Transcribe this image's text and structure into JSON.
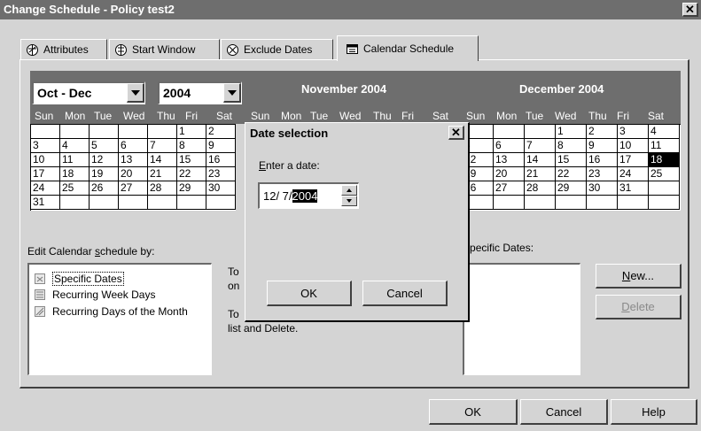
{
  "window": {
    "title": "Change Schedule - Policy test2",
    "close_glyph": "✕"
  },
  "tabs": [
    {
      "label": "Attributes",
      "icon": "attributes-icon"
    },
    {
      "label": "Start Window",
      "icon": "start-window-icon"
    },
    {
      "label": "Exclude Dates",
      "icon": "exclude-dates-icon"
    },
    {
      "label": "Calendar Schedule",
      "icon": "calendar-icon",
      "active": true
    }
  ],
  "calendar": {
    "range_select": "Oct - Dec",
    "year_select": "2004",
    "weekdays": [
      "Sun",
      "Mon",
      "Tue",
      "Wed",
      "Thu",
      "Fri",
      "Sat"
    ],
    "months": [
      {
        "title": "",
        "weeks": [
          [
            "",
            "",
            "",
            "",
            "",
            "1",
            "2"
          ],
          [
            "3",
            "4",
            "5",
            "6",
            "7",
            "8",
            "9"
          ],
          [
            "10",
            "11",
            "12",
            "13",
            "14",
            "15",
            "16"
          ],
          [
            "17",
            "18",
            "19",
            "20",
            "21",
            "22",
            "23"
          ],
          [
            "24",
            "25",
            "26",
            "27",
            "28",
            "29",
            "30"
          ],
          [
            "31",
            "",
            "",
            "",
            "",
            "",
            ""
          ]
        ]
      },
      {
        "title": "November 2004",
        "weeks": []
      },
      {
        "title": "December 2004",
        "weeks": [
          [
            "",
            "",
            "",
            "1",
            "2",
            "3",
            "4"
          ],
          [
            "5",
            "6",
            "7",
            "8",
            "9",
            "10",
            "11"
          ],
          [
            "12",
            "13",
            "14",
            "15",
            "16",
            "17",
            "18"
          ],
          [
            "19",
            "20",
            "21",
            "22",
            "23",
            "24",
            "25"
          ],
          [
            "26",
            "27",
            "28",
            "29",
            "30",
            "31",
            ""
          ],
          [
            "",
            "",
            "",
            "",
            "",
            "",
            ""
          ]
        ],
        "selected_day": "18"
      }
    ]
  },
  "edit_by": {
    "label_pre": "Edit Calendar ",
    "label_u": "s",
    "label_post": "chedule by:",
    "items": [
      {
        "label": "Specific Dates",
        "icon": "specific-dates-icon",
        "selected": true
      },
      {
        "label": "Recurring Week Days",
        "icon": "recurring-week-days-icon"
      },
      {
        "label": "Recurring Days of the Month",
        "icon": "recurring-days-month-icon"
      }
    ]
  },
  "help_text": {
    "line1": "To",
    "line2": "on",
    "line3": "To",
    "line4": "list and Delete."
  },
  "specific_dates": {
    "label_u": "S",
    "label_rest": "pecific Dates:",
    "new_u": "N",
    "new_rest": "ew...",
    "delete_u": "D",
    "delete_rest": "elete"
  },
  "dialog": {
    "title": "Date selection",
    "label_u": "E",
    "label_rest": "nter a date:",
    "date_prefix": "12/  7/",
    "date_selected": "2004",
    "ok": "OK",
    "cancel": "Cancel"
  },
  "footer": {
    "ok": "OK",
    "cancel": "Cancel",
    "help": "Help"
  }
}
